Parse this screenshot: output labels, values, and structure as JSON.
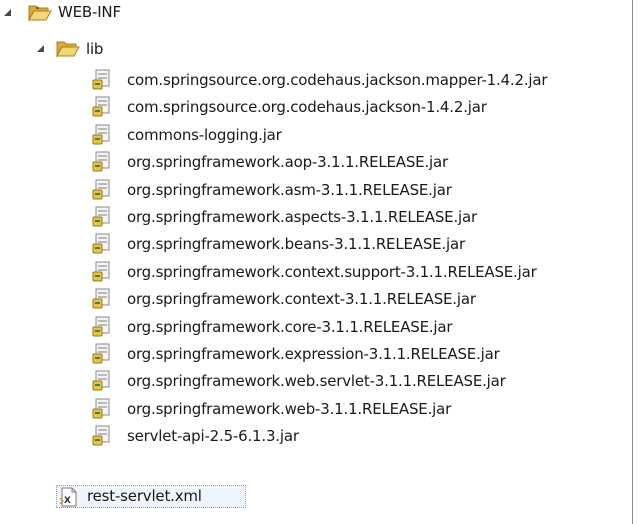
{
  "tree": {
    "root": {
      "label": "WEB-INF",
      "icon": "folder-open-icon",
      "expanded": true
    },
    "lib": {
      "label": "lib",
      "icon": "folder-open-icon",
      "expanded": true
    },
    "jars": [
      {
        "label": "com.springsource.org.codehaus.jackson.mapper-1.4.2.jar",
        "icon": "jar-file-icon"
      },
      {
        "label": "com.springsource.org.codehaus.jackson-1.4.2.jar",
        "icon": "jar-file-icon"
      },
      {
        "label": "commons-logging.jar",
        "icon": "jar-file-icon"
      },
      {
        "label": "org.springframework.aop-3.1.1.RELEASE.jar",
        "icon": "jar-file-icon"
      },
      {
        "label": "org.springframework.asm-3.1.1.RELEASE.jar",
        "icon": "jar-file-icon"
      },
      {
        "label": "org.springframework.aspects-3.1.1.RELEASE.jar",
        "icon": "jar-file-icon"
      },
      {
        "label": "org.springframework.beans-3.1.1.RELEASE.jar",
        "icon": "jar-file-icon"
      },
      {
        "label": "org.springframework.context.support-3.1.1.RELEASE.jar",
        "icon": "jar-file-icon"
      },
      {
        "label": "org.springframework.context-3.1.1.RELEASE.jar",
        "icon": "jar-file-icon"
      },
      {
        "label": "org.springframework.core-3.1.1.RELEASE.jar",
        "icon": "jar-file-icon"
      },
      {
        "label": "org.springframework.expression-3.1.1.RELEASE.jar",
        "icon": "jar-file-icon"
      },
      {
        "label": "org.springframework.web.servlet-3.1.1.RELEASE.jar",
        "icon": "jar-file-icon"
      },
      {
        "label": "org.springframework.web-3.1.1.RELEASE.jar",
        "icon": "jar-file-icon"
      },
      {
        "label": "servlet-api-2.5-6.1.3.jar",
        "icon": "jar-file-icon"
      }
    ],
    "xml_file": {
      "label": "rest-servlet.xml",
      "icon": "xml-file-icon",
      "selected": true
    }
  },
  "colors": {
    "folder": "#e8c15a",
    "jar_body": "#f0f0f0",
    "jar_accent": "#3a8a3a",
    "selection_border": "#7da2ce"
  }
}
